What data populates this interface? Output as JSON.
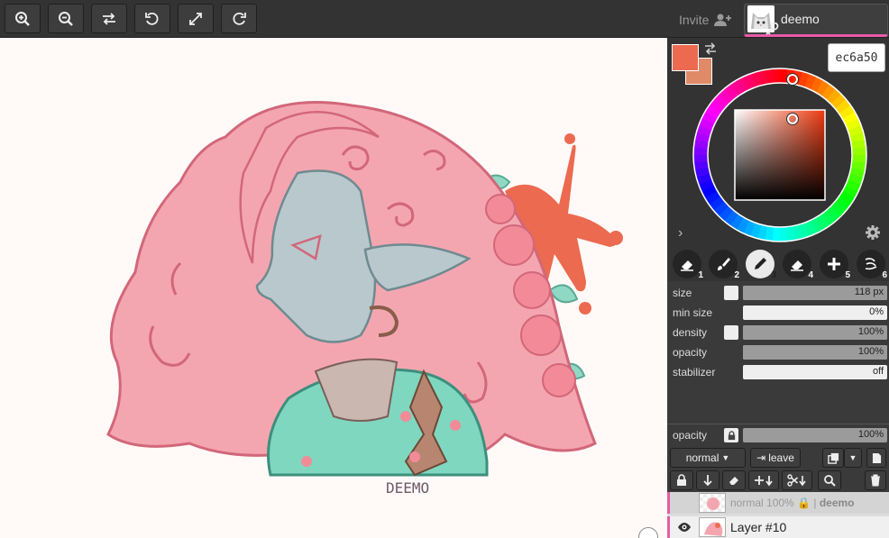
{
  "toolbar": {
    "buttons": [
      {
        "name": "zoom-in-button",
        "icon": "zoom-in-icon"
      },
      {
        "name": "zoom-out-button",
        "icon": "zoom-out-icon"
      },
      {
        "name": "flip-button",
        "icon": "swap-horizontal-icon"
      },
      {
        "name": "rotate-left-button",
        "icon": "rotate-ccw-icon"
      },
      {
        "name": "fit-button",
        "icon": "expand-icon"
      },
      {
        "name": "rotate-right-button",
        "icon": "rotate-cw-icon"
      }
    ],
    "invite_label": "Invite"
  },
  "user": {
    "name": "deemo"
  },
  "color": {
    "primary": "#ec6a50",
    "secondary": "#e08a68",
    "hex": "ec6a50"
  },
  "brushes": [
    {
      "num": "1",
      "icon": "eraser-icon"
    },
    {
      "num": "2",
      "icon": "brush-icon"
    },
    {
      "num": "3",
      "icon": "pencil-icon",
      "selected": true
    },
    {
      "num": "4",
      "icon": "eraser-icon"
    },
    {
      "num": "5",
      "icon": "plus-icon"
    },
    {
      "num": "6",
      "icon": "smudge-icon"
    }
  ],
  "sliders": [
    {
      "label": "size",
      "value": "118 px",
      "fill": 1.0,
      "has_check": true
    },
    {
      "label": "min size",
      "value": "0%",
      "fill": 0.0,
      "has_check": false
    },
    {
      "label": "density",
      "value": "100%",
      "fill": 1.0,
      "has_check": true
    },
    {
      "label": "opacity",
      "value": "100%",
      "fill": 1.0,
      "has_check": false
    },
    {
      "label": "stabilizer",
      "value": "off",
      "fill": 0.0,
      "has_check": false
    }
  ],
  "layer_opacity": {
    "label": "opacity",
    "value": "100%"
  },
  "layer_controls": {
    "blend_mode": "normal",
    "leave_label": "leave"
  },
  "layers": {
    "ghost": {
      "mode": "normal",
      "opacity": "100%",
      "owner": "deemo"
    },
    "active": {
      "name": "Layer #10"
    }
  },
  "canvas": {
    "signature": "DEEMO"
  }
}
